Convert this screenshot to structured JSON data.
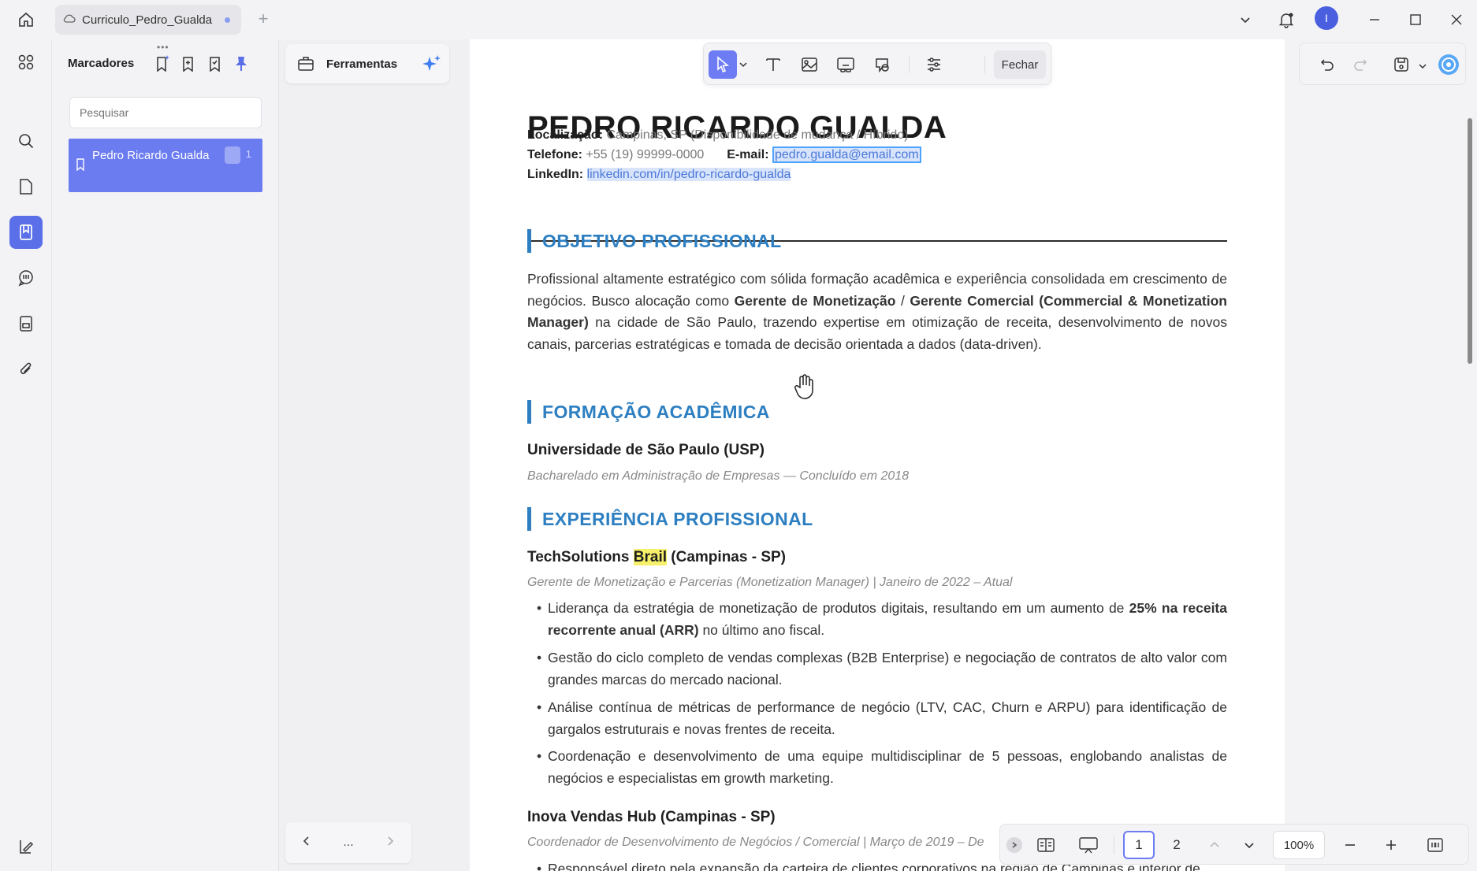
{
  "titlebar": {
    "tab_title": "Curriculo_Pedro_Gualda",
    "avatar_initial": "I"
  },
  "bookmarks": {
    "title": "Marcadores",
    "search_placeholder": "Pesquisar",
    "items": [
      {
        "label": "Pedro Ricardo Gualda",
        "page": "1"
      }
    ]
  },
  "tools": {
    "title": "Ferramentas",
    "footer_more": "..."
  },
  "floating_toolbar": {
    "close_label": "Fechar"
  },
  "document": {
    "name": "PEDRO RICARDO GUALDA",
    "contact": {
      "location_label": "Localização:",
      "location_value": "Campinas, SP (Disponibilidade de mudança / Híbrido)",
      "phone_label": "Telefone:",
      "phone_value": "+55 (19) 99999-0000",
      "email_label": "E-mail:",
      "email_value": "pedro.gualda@email.com",
      "linkedin_label": "LinkedIn:",
      "linkedin_value": "linkedin.com/in/pedro-ricardo-gualda"
    },
    "objective": {
      "heading": "OBJETIVO PROFISSIONAL",
      "t1": "Profissional altamente estratégico com sólida formação acadêmica e experiência consolidada em crescimento de negócios. Busco alocação como ",
      "b1": "Gerente de Monetização",
      "t2": " / ",
      "b2": "Gerente Comercial (Commercial & Monetization Manager)",
      "t3": " na cidade de São Paulo, trazendo expertise em otimização de receita, desenvolvimento de novos canais, parcerias estratégicas e tomada de decisão orientada a dados (data-driven)."
    },
    "education": {
      "heading": "FORMAÇÃO ACADÊMICA",
      "school": "Universidade de São Paulo (USP)",
      "degree": "Bacharelado em Administração de Empresas — Concluído em 2018"
    },
    "experience": {
      "heading": "EXPERIÊNCIA PROFISSIONAL",
      "job1": {
        "org_pre": "TechSolutions ",
        "org_hl": "Brail",
        "org_post": " (Campinas - SP)",
        "role": "Gerente de Monetização e Parcerias (Monetization Manager) | Janeiro de 2022 – Atual",
        "b1_pre": "Liderança da estratégia de monetização de produtos digitais, resultando em um aumento de ",
        "b1_bold": "25% na receita recorrente anual (ARR)",
        "b1_post": " no último ano fiscal.",
        "b2": "Gestão do ciclo completo de vendas complexas (B2B Enterprise) e negociação de contratos de alto valor com grandes marcas do mercado nacional.",
        "b3": "Análise contínua de métricas de performance de negócio (LTV, CAC, Churn e ARPU) para identificação de gargalos estruturais e novas frentes de receita.",
        "b4": "Coordenação e desenvolvimento de uma equipe multidisciplinar de 5 pessoas, englobando analistas de negócios e especialistas em growth marketing."
      },
      "job2": {
        "org": "Inova Vendas Hub (Campinas - SP)",
        "role": "Coordenador de Desenvolvimento de Negócios / Comercial | Março de 2019 – De",
        "b1": "Responsável direto pela expansão da carteira de clientes corporativos na região de Campinas e interior de"
      }
    }
  },
  "page_nav": {
    "pages": [
      "1",
      "2"
    ],
    "current_page": "1",
    "zoom": "100%"
  }
}
